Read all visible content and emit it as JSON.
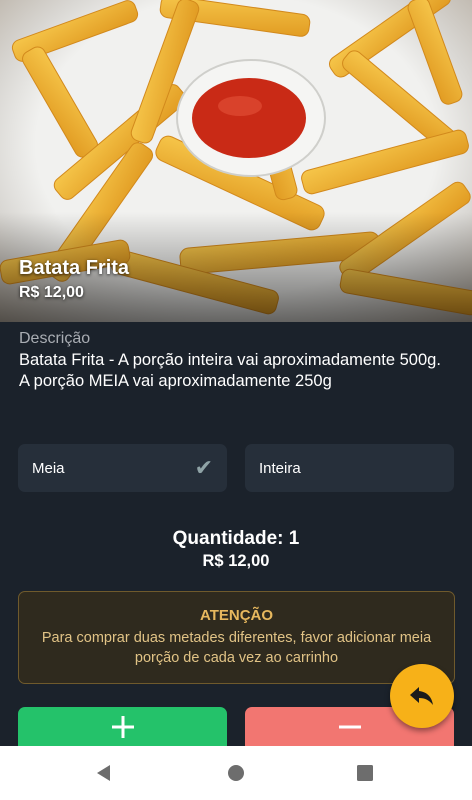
{
  "product": {
    "name": "Batata Frita",
    "price": "R$ 12,00"
  },
  "description": {
    "label": "Descrição",
    "lines": [
      "Batata Frita - A porção inteira vai aproximadamente 500g.",
      "A porção MEIA vai aproximadamente 250g"
    ]
  },
  "options": [
    {
      "label": "Meia",
      "selected": true
    },
    {
      "label": "Inteira",
      "selected": false
    }
  ],
  "quantity": {
    "label": "Quantidade: 1",
    "total": "R$ 12,00"
  },
  "warning": {
    "title": "ATENÇÃO",
    "text": "Para comprar duas metades diferentes, favor adicionar meia porção de cada vez ao carrinho"
  },
  "buttons": {
    "plus_icon": "plus-icon",
    "minus_icon": "minus-icon",
    "back_icon": "reply-arrow-icon"
  },
  "colors": {
    "background": "#1b222b",
    "card": "#262f3a",
    "plus_button": "#24c26a",
    "minus_button": "#f27671",
    "fab": "#f7b118",
    "warning_text": "#e7b85e"
  }
}
